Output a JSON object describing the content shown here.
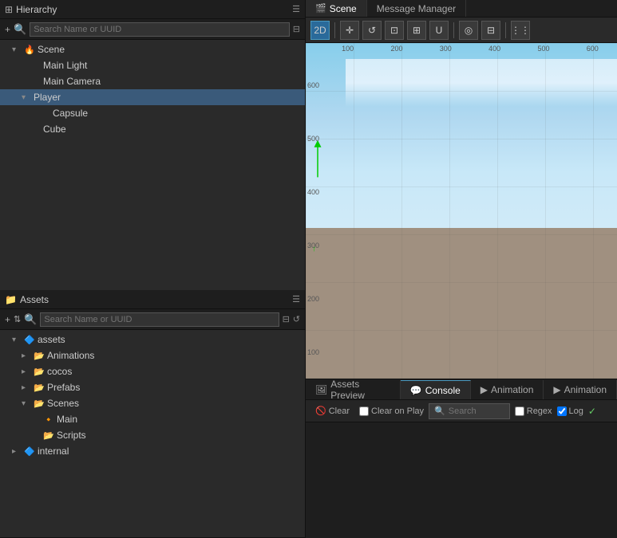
{
  "topTabs": [
    {
      "id": "hierarchy",
      "label": "Hierarchy",
      "active": true,
      "icon": "⊞"
    },
    {
      "id": "scene",
      "label": "Scene",
      "active": true,
      "icon": "🎬"
    },
    {
      "id": "message-manager",
      "label": "Message Manager",
      "active": false,
      "icon": ""
    }
  ],
  "hierarchy": {
    "title": "Hierarchy",
    "searchPlaceholder": "Search Name or UUID",
    "tree": [
      {
        "id": "scene",
        "label": "Scene",
        "depth": 0,
        "hasArrow": true,
        "open": true,
        "icon": "flame"
      },
      {
        "id": "main-light",
        "label": "Main Light",
        "depth": 1,
        "hasArrow": false,
        "icon": "none"
      },
      {
        "id": "main-camera",
        "label": "Main Camera",
        "depth": 1,
        "hasArrow": false,
        "icon": "none"
      },
      {
        "id": "player",
        "label": "Player",
        "depth": 1,
        "hasArrow": true,
        "open": true,
        "icon": "none",
        "selected": true
      },
      {
        "id": "capsule",
        "label": "Capsule",
        "depth": 2,
        "hasArrow": false,
        "icon": "none"
      },
      {
        "id": "cube",
        "label": "Cube",
        "depth": 1,
        "hasArrow": false,
        "icon": "none"
      }
    ]
  },
  "assets": {
    "title": "Assets",
    "searchPlaceholder": "Search Name or UUID",
    "tree": [
      {
        "id": "assets-root",
        "label": "assets",
        "depth": 0,
        "hasArrow": true,
        "open": true,
        "icon": "folder-blue"
      },
      {
        "id": "animations",
        "label": "Animations",
        "depth": 1,
        "hasArrow": true,
        "open": false,
        "icon": "folder-blue"
      },
      {
        "id": "cocos",
        "label": "cocos",
        "depth": 1,
        "hasArrow": true,
        "open": false,
        "icon": "folder-blue"
      },
      {
        "id": "prefabs",
        "label": "Prefabs",
        "depth": 1,
        "hasArrow": true,
        "open": false,
        "icon": "folder-blue"
      },
      {
        "id": "scenes",
        "label": "Scenes",
        "depth": 1,
        "hasArrow": true,
        "open": true,
        "icon": "folder-blue"
      },
      {
        "id": "main-scene",
        "label": "Main",
        "depth": 2,
        "hasArrow": false,
        "icon": "flame-yellow"
      },
      {
        "id": "scripts",
        "label": "Scripts",
        "depth": 2,
        "hasArrow": false,
        "icon": "folder-blue"
      },
      {
        "id": "internal",
        "label": "internal",
        "depth": 0,
        "hasArrow": true,
        "open": false,
        "icon": "folder-blue"
      }
    ]
  },
  "sceneToolbar": {
    "buttons": [
      {
        "id": "2d",
        "label": "2D",
        "active": true
      },
      {
        "id": "move",
        "label": "✛",
        "active": false
      },
      {
        "id": "rotate",
        "label": "↺",
        "active": false
      },
      {
        "id": "scale",
        "label": "⊡",
        "active": false
      },
      {
        "id": "rect",
        "label": "⊞",
        "active": false
      },
      {
        "id": "transform",
        "label": "U",
        "active": false
      },
      {
        "id": "pivot",
        "label": "◎",
        "active": false
      },
      {
        "id": "snap",
        "label": "⊟",
        "active": false
      },
      {
        "id": "chart",
        "label": "⋮",
        "active": false
      }
    ]
  },
  "sceneRuler": {
    "topLabels": [
      "100",
      "200",
      "300",
      "400",
      "500",
      "600"
    ],
    "leftLabels": [
      "600",
      "500",
      "400",
      "300",
      "200",
      "100"
    ]
  },
  "bottomPanel": {
    "tabs": [
      {
        "id": "assets-preview",
        "label": "Assets Preview",
        "active": false,
        "icon": "🖼"
      },
      {
        "id": "console",
        "label": "Console",
        "active": true,
        "icon": "💬"
      },
      {
        "id": "animation",
        "label": "Animation",
        "active": false,
        "icon": "▶"
      },
      {
        "id": "animation2",
        "label": "Animation",
        "active": false,
        "icon": "▶"
      }
    ],
    "console": {
      "clearLabel": "Clear",
      "clearOnPlayLabel": "Clear on Play",
      "searchPlaceholder": "Search",
      "regexLabel": "Regex",
      "logLabel": "Log"
    }
  }
}
